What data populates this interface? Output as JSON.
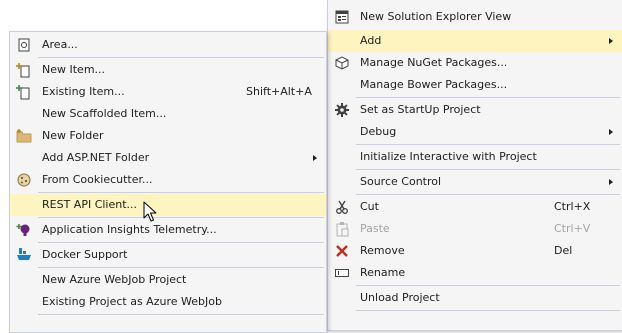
{
  "main_menu": {
    "items": [
      {
        "label": "New Solution Explorer View",
        "icon": "solution-explorer-icon"
      },
      {
        "label": "Add",
        "submenu": true,
        "highlighted": true
      },
      {
        "label": "Manage NuGet Packages...",
        "icon": "nuget-icon"
      },
      {
        "label": "Manage Bower Packages..."
      },
      {
        "label": "Set as StartUp Project",
        "icon": "gear-icon"
      },
      {
        "label": "Debug",
        "submenu": true
      },
      {
        "label": "Initialize Interactive with Project"
      },
      {
        "label": "Source Control",
        "submenu": true
      },
      {
        "label": "Cut",
        "shortcut": "Ctrl+X",
        "icon": "scissors-icon"
      },
      {
        "label": "Paste",
        "shortcut": "Ctrl+V",
        "icon": "paste-icon",
        "disabled": true
      },
      {
        "label": "Remove",
        "shortcut": "Del",
        "icon": "remove-x-icon"
      },
      {
        "label": "Rename",
        "icon": "rename-icon"
      },
      {
        "label": "Unload Project"
      }
    ]
  },
  "add_submenu": {
    "items": [
      {
        "label": "Area...",
        "icon": "area-icon"
      },
      {
        "label": "New Item...",
        "icon": "new-item-icon"
      },
      {
        "label": "Existing Item...",
        "shortcut": "Shift+Alt+A",
        "icon": "existing-item-icon"
      },
      {
        "label": "New Scaffolded Item..."
      },
      {
        "label": "New Folder",
        "icon": "folder-icon"
      },
      {
        "label": "Add ASP.NET Folder",
        "submenu": true
      },
      {
        "label": "From Cookiecutter...",
        "icon": "cookiecutter-icon"
      },
      {
        "label": "REST API Client...",
        "highlighted": true
      },
      {
        "label": "Application Insights Telemetry...",
        "icon": "app-insights-icon"
      },
      {
        "label": "Docker Support",
        "icon": "docker-icon"
      },
      {
        "label": "New Azure WebJob Project"
      },
      {
        "label": "Existing Project as Azure WebJob"
      }
    ]
  },
  "colors": {
    "menu_bg": "#f5f5f5",
    "menu_border": "#cccedb",
    "highlight": "#fdf4bf",
    "text": "#1e1e1e",
    "disabled_text": "#a2a4a5"
  }
}
